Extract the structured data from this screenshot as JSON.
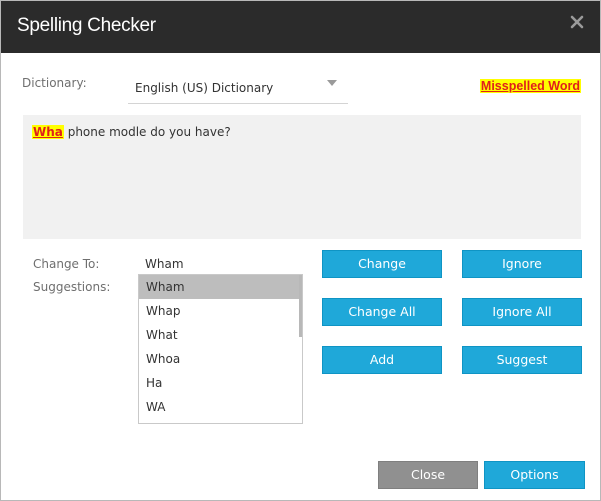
{
  "dialog": {
    "title": "Spelling Checker",
    "close_icon": "close-icon"
  },
  "dictionary": {
    "label": "Dictionary:",
    "selected": "English (US) Dictionary"
  },
  "legend": {
    "label": "Misspelled Word",
    "color": "#e0201b",
    "highlight": "#ffff00"
  },
  "text": {
    "misspelled_word": "Wha",
    "rest": " phone modle do you have?"
  },
  "change_to": {
    "label": "Change To:",
    "value": "Wham"
  },
  "suggestions": {
    "label": "Suggestions:",
    "items": [
      "Wham",
      "Whap",
      "What",
      "Whoa",
      "Ha",
      "WA"
    ],
    "selected_index": 0
  },
  "buttons": {
    "change": "Change",
    "ignore": "Ignore",
    "change_all": "Change All",
    "ignore_all": "Ignore All",
    "add": "Add",
    "suggest": "Suggest",
    "close": "Close",
    "options": "Options"
  },
  "colors": {
    "accent": "#1fa8d9",
    "titlebar": "#2b2b2b",
    "secondary_button": "#909090"
  }
}
